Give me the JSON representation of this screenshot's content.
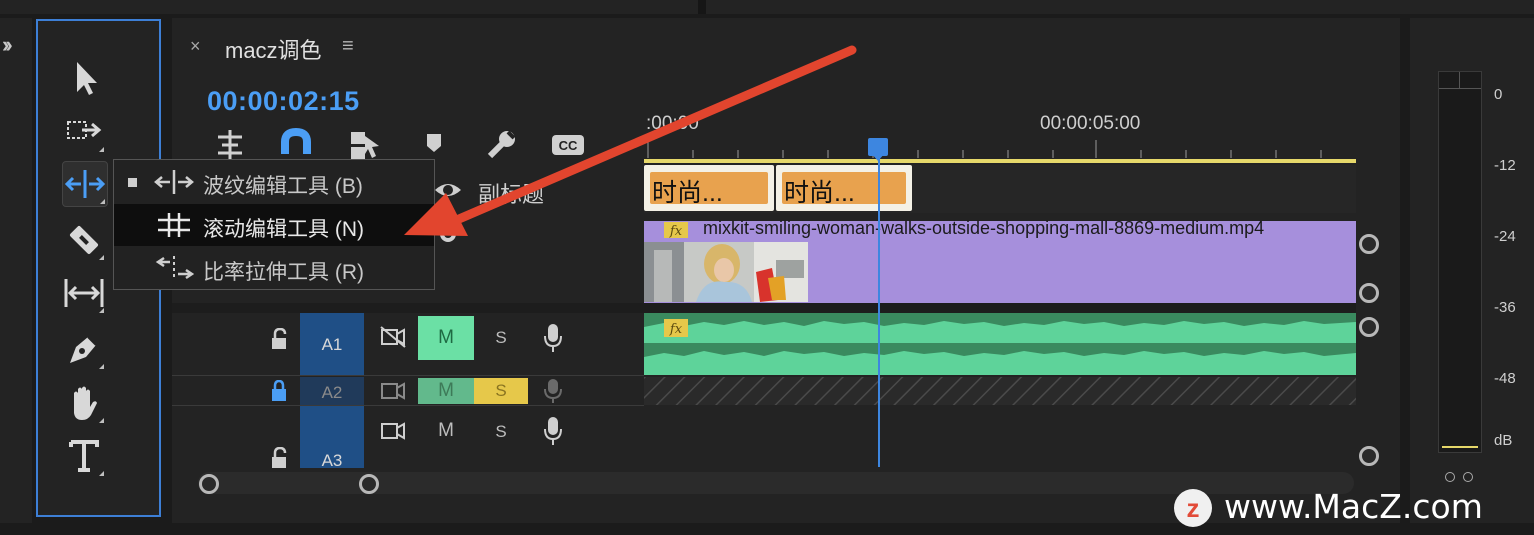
{
  "sequence": {
    "tab_title": "macz调色",
    "close_glyph": "×",
    "menu_glyph": "≡",
    "timecode": "00:00:02:15"
  },
  "ruler": {
    "start_label": ":00:00",
    "mark_label": "00:00:05:00"
  },
  "tools_flyout": {
    "items": [
      {
        "label": "波纹编辑工具 (B)",
        "selected": true,
        "icon": "ripple-edit-icon"
      },
      {
        "label": "滚动编辑工具 (N)",
        "selected": false,
        "icon": "rolling-edit-icon"
      },
      {
        "label": "比率拉伸工具 (R)",
        "selected": false,
        "icon": "rate-stretch-icon"
      }
    ]
  },
  "tracks": {
    "subtitle_label": "副标题",
    "captions": [
      "时尚...",
      "时尚..."
    ],
    "video_clip_name": "mixkit-smiling-woman-walks-outside-shopping-mall-8869-medium.mp4",
    "fx_badge": "fx",
    "audio": [
      {
        "name": "A1",
        "mute": "M",
        "solo": "S"
      },
      {
        "name": "A2",
        "mute": "M",
        "solo": "S"
      },
      {
        "name": "A3",
        "mute": "M",
        "solo": "S"
      }
    ]
  },
  "meter": {
    "labels": [
      "0",
      "-12",
      "-24",
      "-36",
      "-48",
      "dB"
    ]
  },
  "watermark": {
    "logo": "z",
    "text": "www.MacZ.com"
  },
  "colors": {
    "accent_blue": "#4b9ef5",
    "caption_orange": "#e8a24e",
    "video_clip": "#a68fdc",
    "audio_clip": "#3a8a5f",
    "mute_green": "#6be0a5",
    "solo_yellow": "#e6c84a",
    "arrow_red": "#e2452e"
  }
}
